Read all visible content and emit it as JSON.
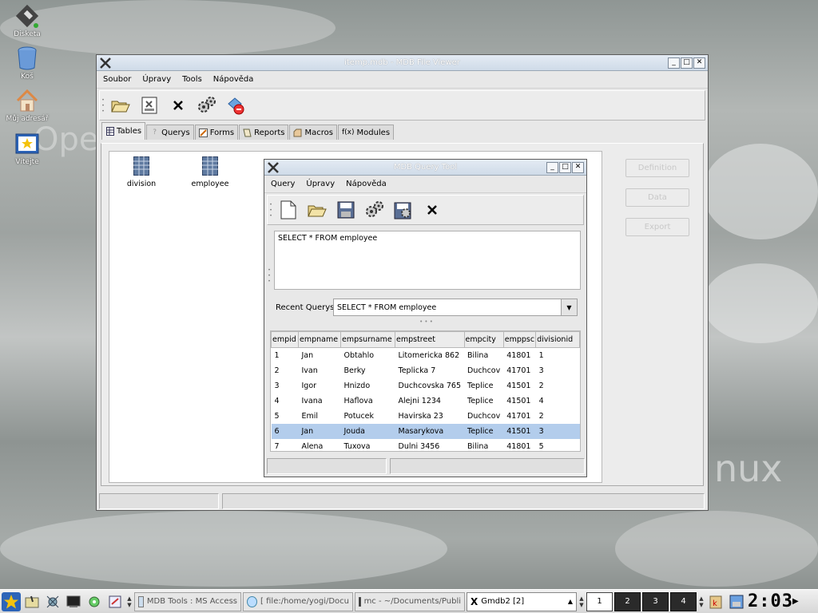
{
  "desktop": {
    "icons": [
      {
        "label": "Disketa",
        "icon": "floppy-disk-icon"
      },
      {
        "label": "Koš",
        "icon": "trash-icon"
      },
      {
        "label": "Můj adresář",
        "icon": "home-folder-icon"
      },
      {
        "label": "Vítejte",
        "icon": "welcome-star-icon"
      }
    ],
    "bg_text_left": "Ope",
    "bg_text_right": "nux"
  },
  "main_window": {
    "title": "itemp.mdb - MDB File Viewer",
    "menu": [
      "Soubor",
      "Úpravy",
      "Tools",
      "Nápověda"
    ],
    "toolbar_icons": [
      "open-folder-icon",
      "properties-icon",
      "close-x-icon",
      "gears-icon",
      "debug-icon"
    ],
    "tabs": [
      {
        "label": "Tables",
        "icon": "table-icon"
      },
      {
        "label": "Querys",
        "icon": "query-icon"
      },
      {
        "label": "Forms",
        "icon": "form-icon"
      },
      {
        "label": "Reports",
        "icon": "report-icon"
      },
      {
        "label": "Macros",
        "icon": "macro-icon"
      },
      {
        "label": "Modules",
        "icon": "fx-icon"
      }
    ],
    "tables": [
      "division",
      "employee"
    ],
    "buttons": {
      "definition": "Definition",
      "data": "Data",
      "export": "Export"
    }
  },
  "query_window": {
    "title": "MDB Query Tool",
    "menu": [
      "Query",
      "Úpravy",
      "Nápověda"
    ],
    "toolbar_icons": [
      "new-document-icon",
      "open-folder-icon",
      "save-icon",
      "gears-icon",
      "save-results-icon",
      "close-x-icon"
    ],
    "sql": "SELECT * FROM employee",
    "recent_label": "Recent Querys:",
    "recent_value": "SELECT * FROM employee",
    "columns": [
      "empid",
      "empname",
      "empsurname",
      "empstreet",
      "empcity",
      "emppsc",
      "divisionid"
    ],
    "rows": [
      [
        "1",
        "Jan",
        "Obtahlo",
        "Litomericka 862",
        "Bilina",
        "41801",
        "1"
      ],
      [
        "2",
        "Ivan",
        "Berky",
        "Teplicka 7",
        "Duchcov",
        "41701",
        "3"
      ],
      [
        "3",
        "Igor",
        "Hnizdo",
        "Duchcovska 765",
        "Teplice",
        "41501",
        "2"
      ],
      [
        "4",
        "Ivana",
        "Haflova",
        "Alejni 1234",
        "Teplice",
        "41501",
        "4"
      ],
      [
        "5",
        "Emil",
        "Potucek",
        "Havirska 23",
        "Duchcov",
        "41701",
        "2"
      ],
      [
        "6",
        "Jan",
        "Jouda",
        "Masarykova",
        "Teplice",
        "41501",
        "3"
      ],
      [
        "7",
        "Alena",
        "Tuxova",
        "Dulni 3456",
        "Bilina",
        "41801",
        "5"
      ]
    ],
    "selected_row": 5
  },
  "taskbar": {
    "launchers": [
      "kde-star-icon",
      "konqueror-icon",
      "network-icon",
      "terminal-icon",
      "tools-icon",
      "help-icon"
    ],
    "tasks": [
      {
        "label": "MDB Tools : MS Access",
        "icon": "window-icon",
        "active": false
      },
      {
        "label": "[ file:/home/yogi/Docu",
        "icon": "konqueror-icon",
        "active": false
      },
      {
        "label": "mc - ~/Documents/Publi",
        "icon": "terminal-icon",
        "active": false
      },
      {
        "label": "Gmdb2 [2]",
        "icon": "x-icon",
        "active": true
      }
    ],
    "desktops": [
      "1",
      "2",
      "3",
      "4"
    ],
    "active_desktop": "1",
    "clock": "2:03"
  },
  "colors": {
    "selection": "#b3cdec",
    "titlebar": "#cfdbe8"
  }
}
